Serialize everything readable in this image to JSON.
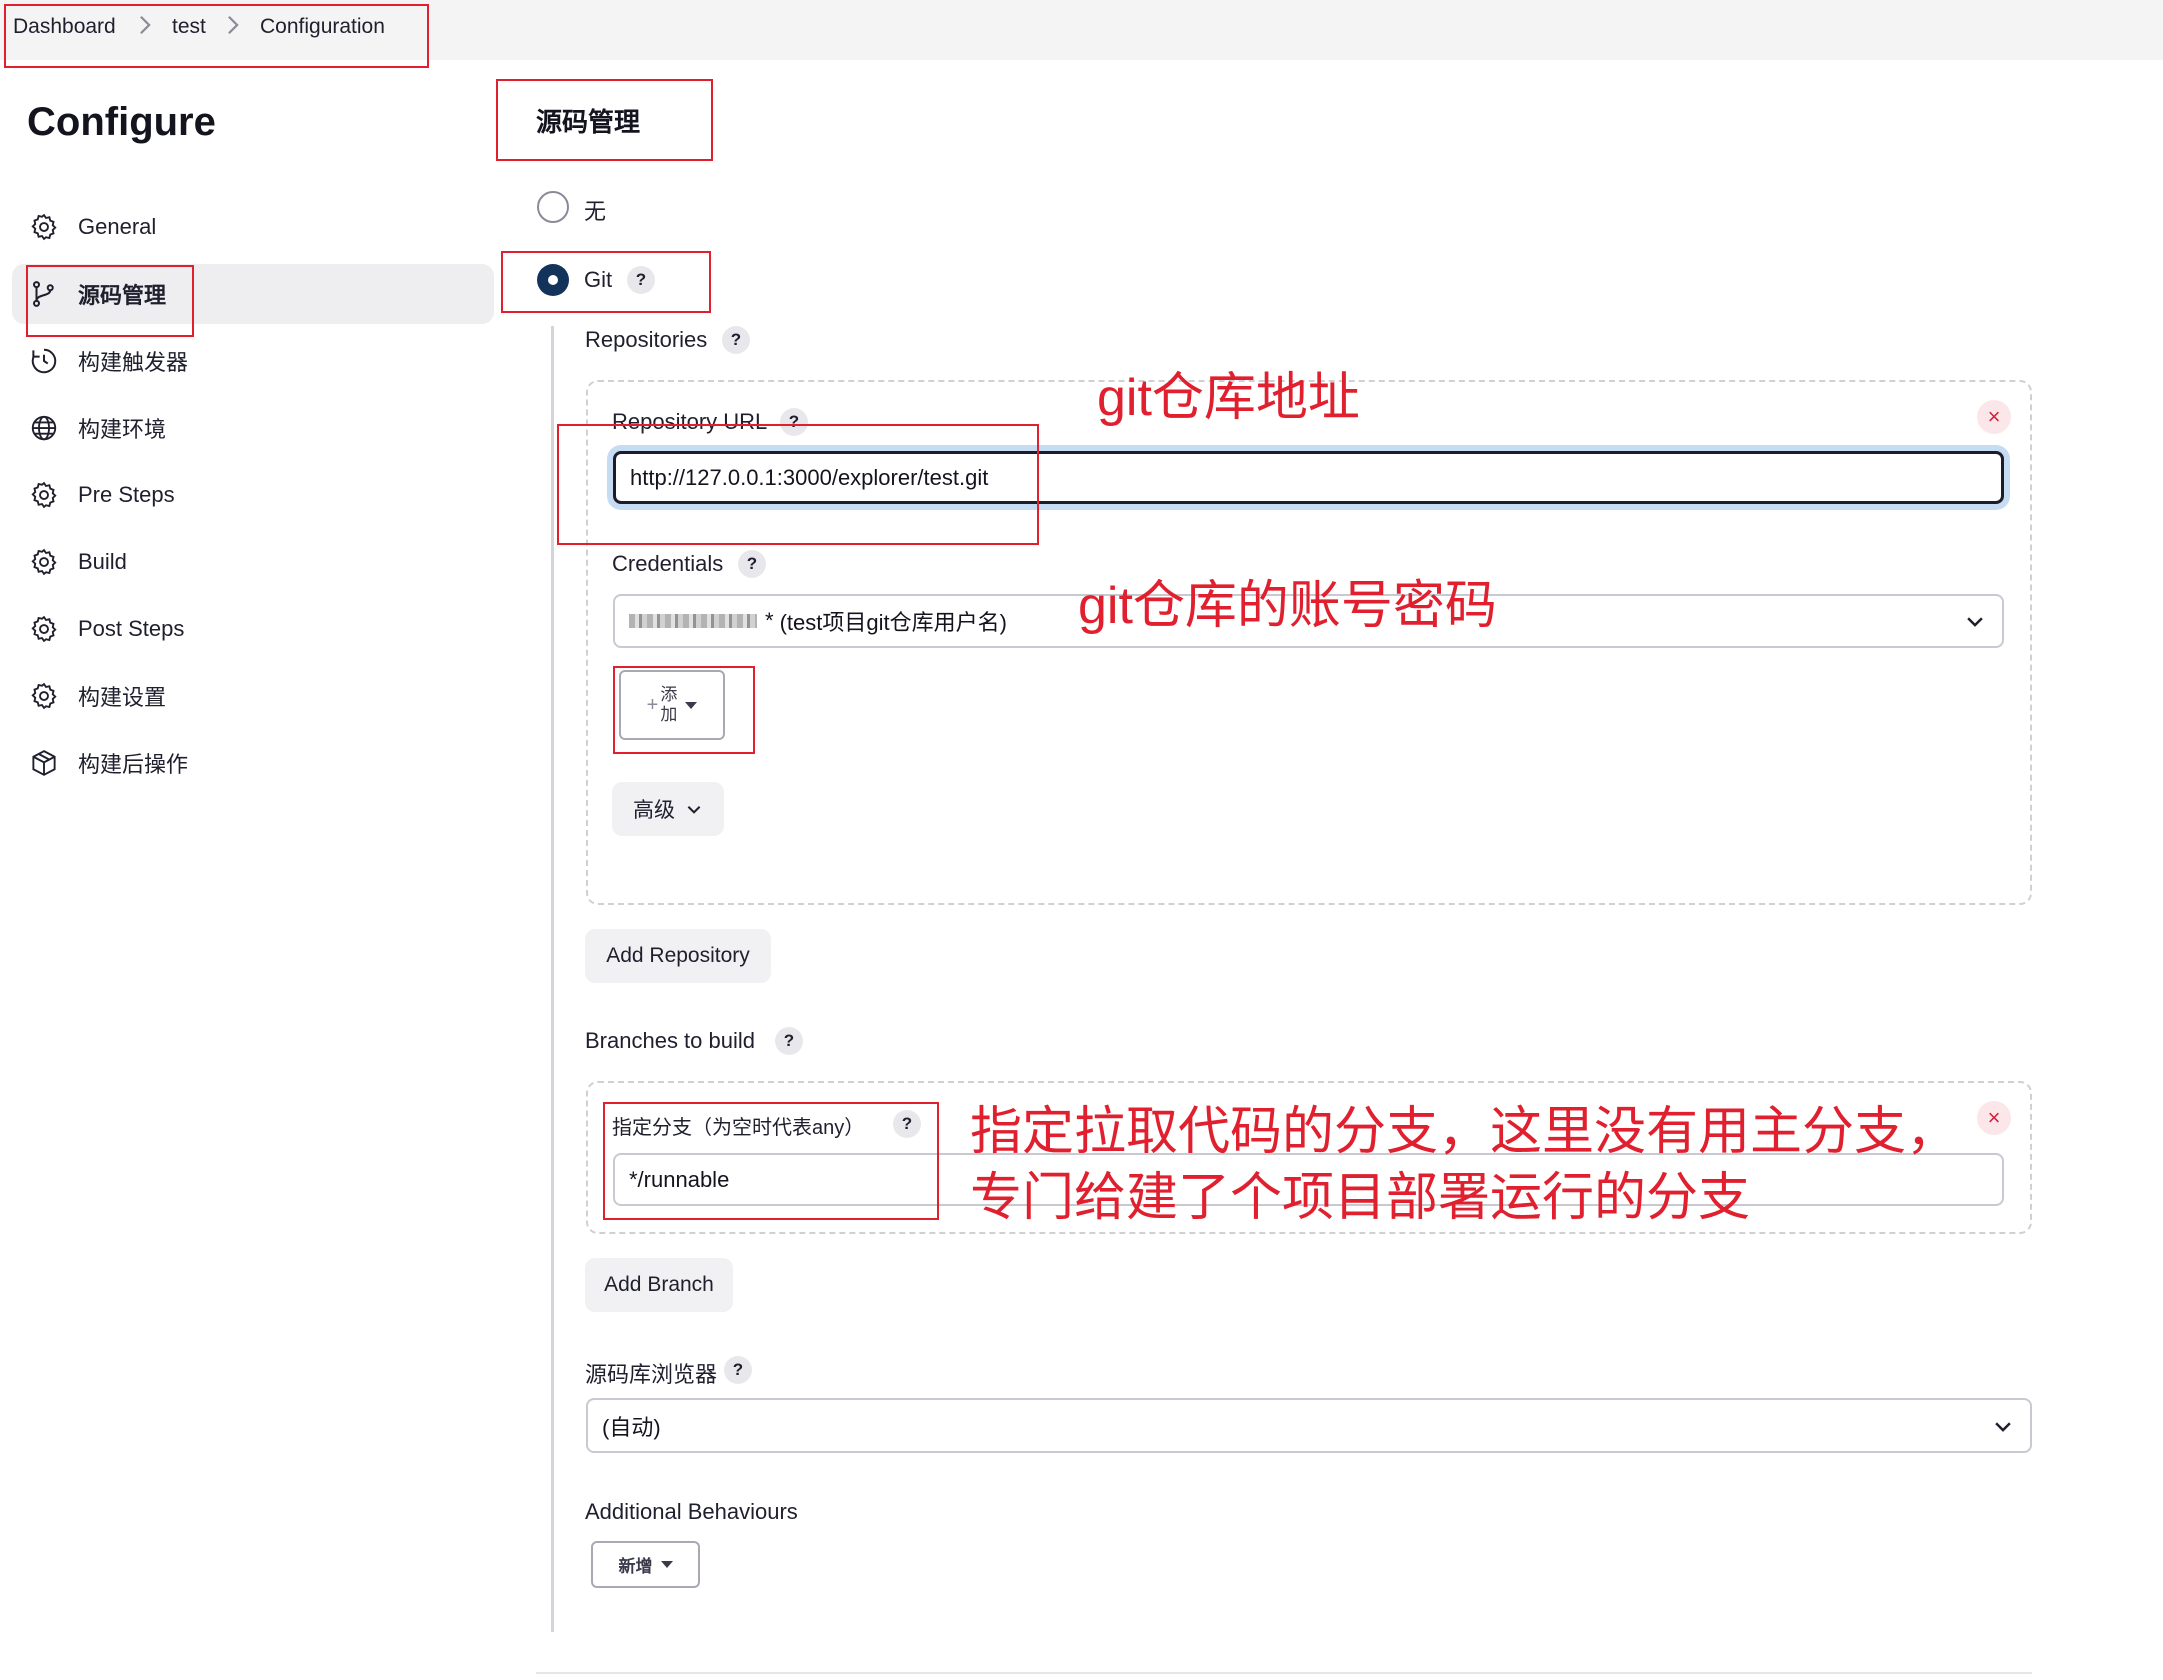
{
  "breadcrumb": {
    "items": [
      "Dashboard",
      "test",
      "Configuration"
    ]
  },
  "sidebar": {
    "title": "Configure",
    "items": [
      {
        "label": "General",
        "icon": "gear-icon"
      },
      {
        "label": "源码管理",
        "icon": "branch-icon"
      },
      {
        "label": "构建触发器",
        "icon": "clock-icon"
      },
      {
        "label": "构建环境",
        "icon": "globe-icon"
      },
      {
        "label": "Pre Steps",
        "icon": "gear-icon"
      },
      {
        "label": "Build",
        "icon": "gear-icon"
      },
      {
        "label": "Post Steps",
        "icon": "gear-icon"
      },
      {
        "label": "构建设置",
        "icon": "gear-icon"
      },
      {
        "label": "构建后操作",
        "icon": "package-icon"
      }
    ],
    "active_index": 1
  },
  "scm": {
    "title": "源码管理",
    "options": [
      {
        "label": "无",
        "selected": false
      },
      {
        "label": "Git",
        "selected": true
      }
    ],
    "help_label": "?",
    "repositories": {
      "label": "Repositories",
      "url_label": "Repository URL",
      "url_value": "http://127.0.0.1:3000/explorer/test.git",
      "credentials_label": "Credentials",
      "credentials_value": "(test项目git仓库用户名)",
      "credentials_masked_suffix": "*",
      "add_button_plus": "+",
      "add_button_line1": "添",
      "add_button_line2": "加",
      "advanced_label": "高级",
      "close_icon": "×"
    },
    "add_repository_label": "Add Repository",
    "branches": {
      "label": "Branches to build",
      "spec_label": "指定分支（为空时代表any）",
      "spec_value": "*/runnable"
    },
    "add_branch_label": "Add Branch",
    "browser": {
      "label": "源码库浏览器",
      "value": "(自动)"
    },
    "additional": {
      "label": "Additional Behaviours",
      "button_label": "新增"
    }
  },
  "annotations": {
    "repo_url_note": "git仓库地址",
    "credentials_note": "git仓库的账号密码",
    "branch_note_line1": "指定拉取代码的分支，这里没有用主分支，",
    "branch_note_line2": "专门给建了个项目部署运行的分支",
    "color": "#e0202e"
  },
  "colors": {
    "accent_radio": "#14335a",
    "focus_ring": "#c6dcf2",
    "danger": "#d2213c"
  }
}
